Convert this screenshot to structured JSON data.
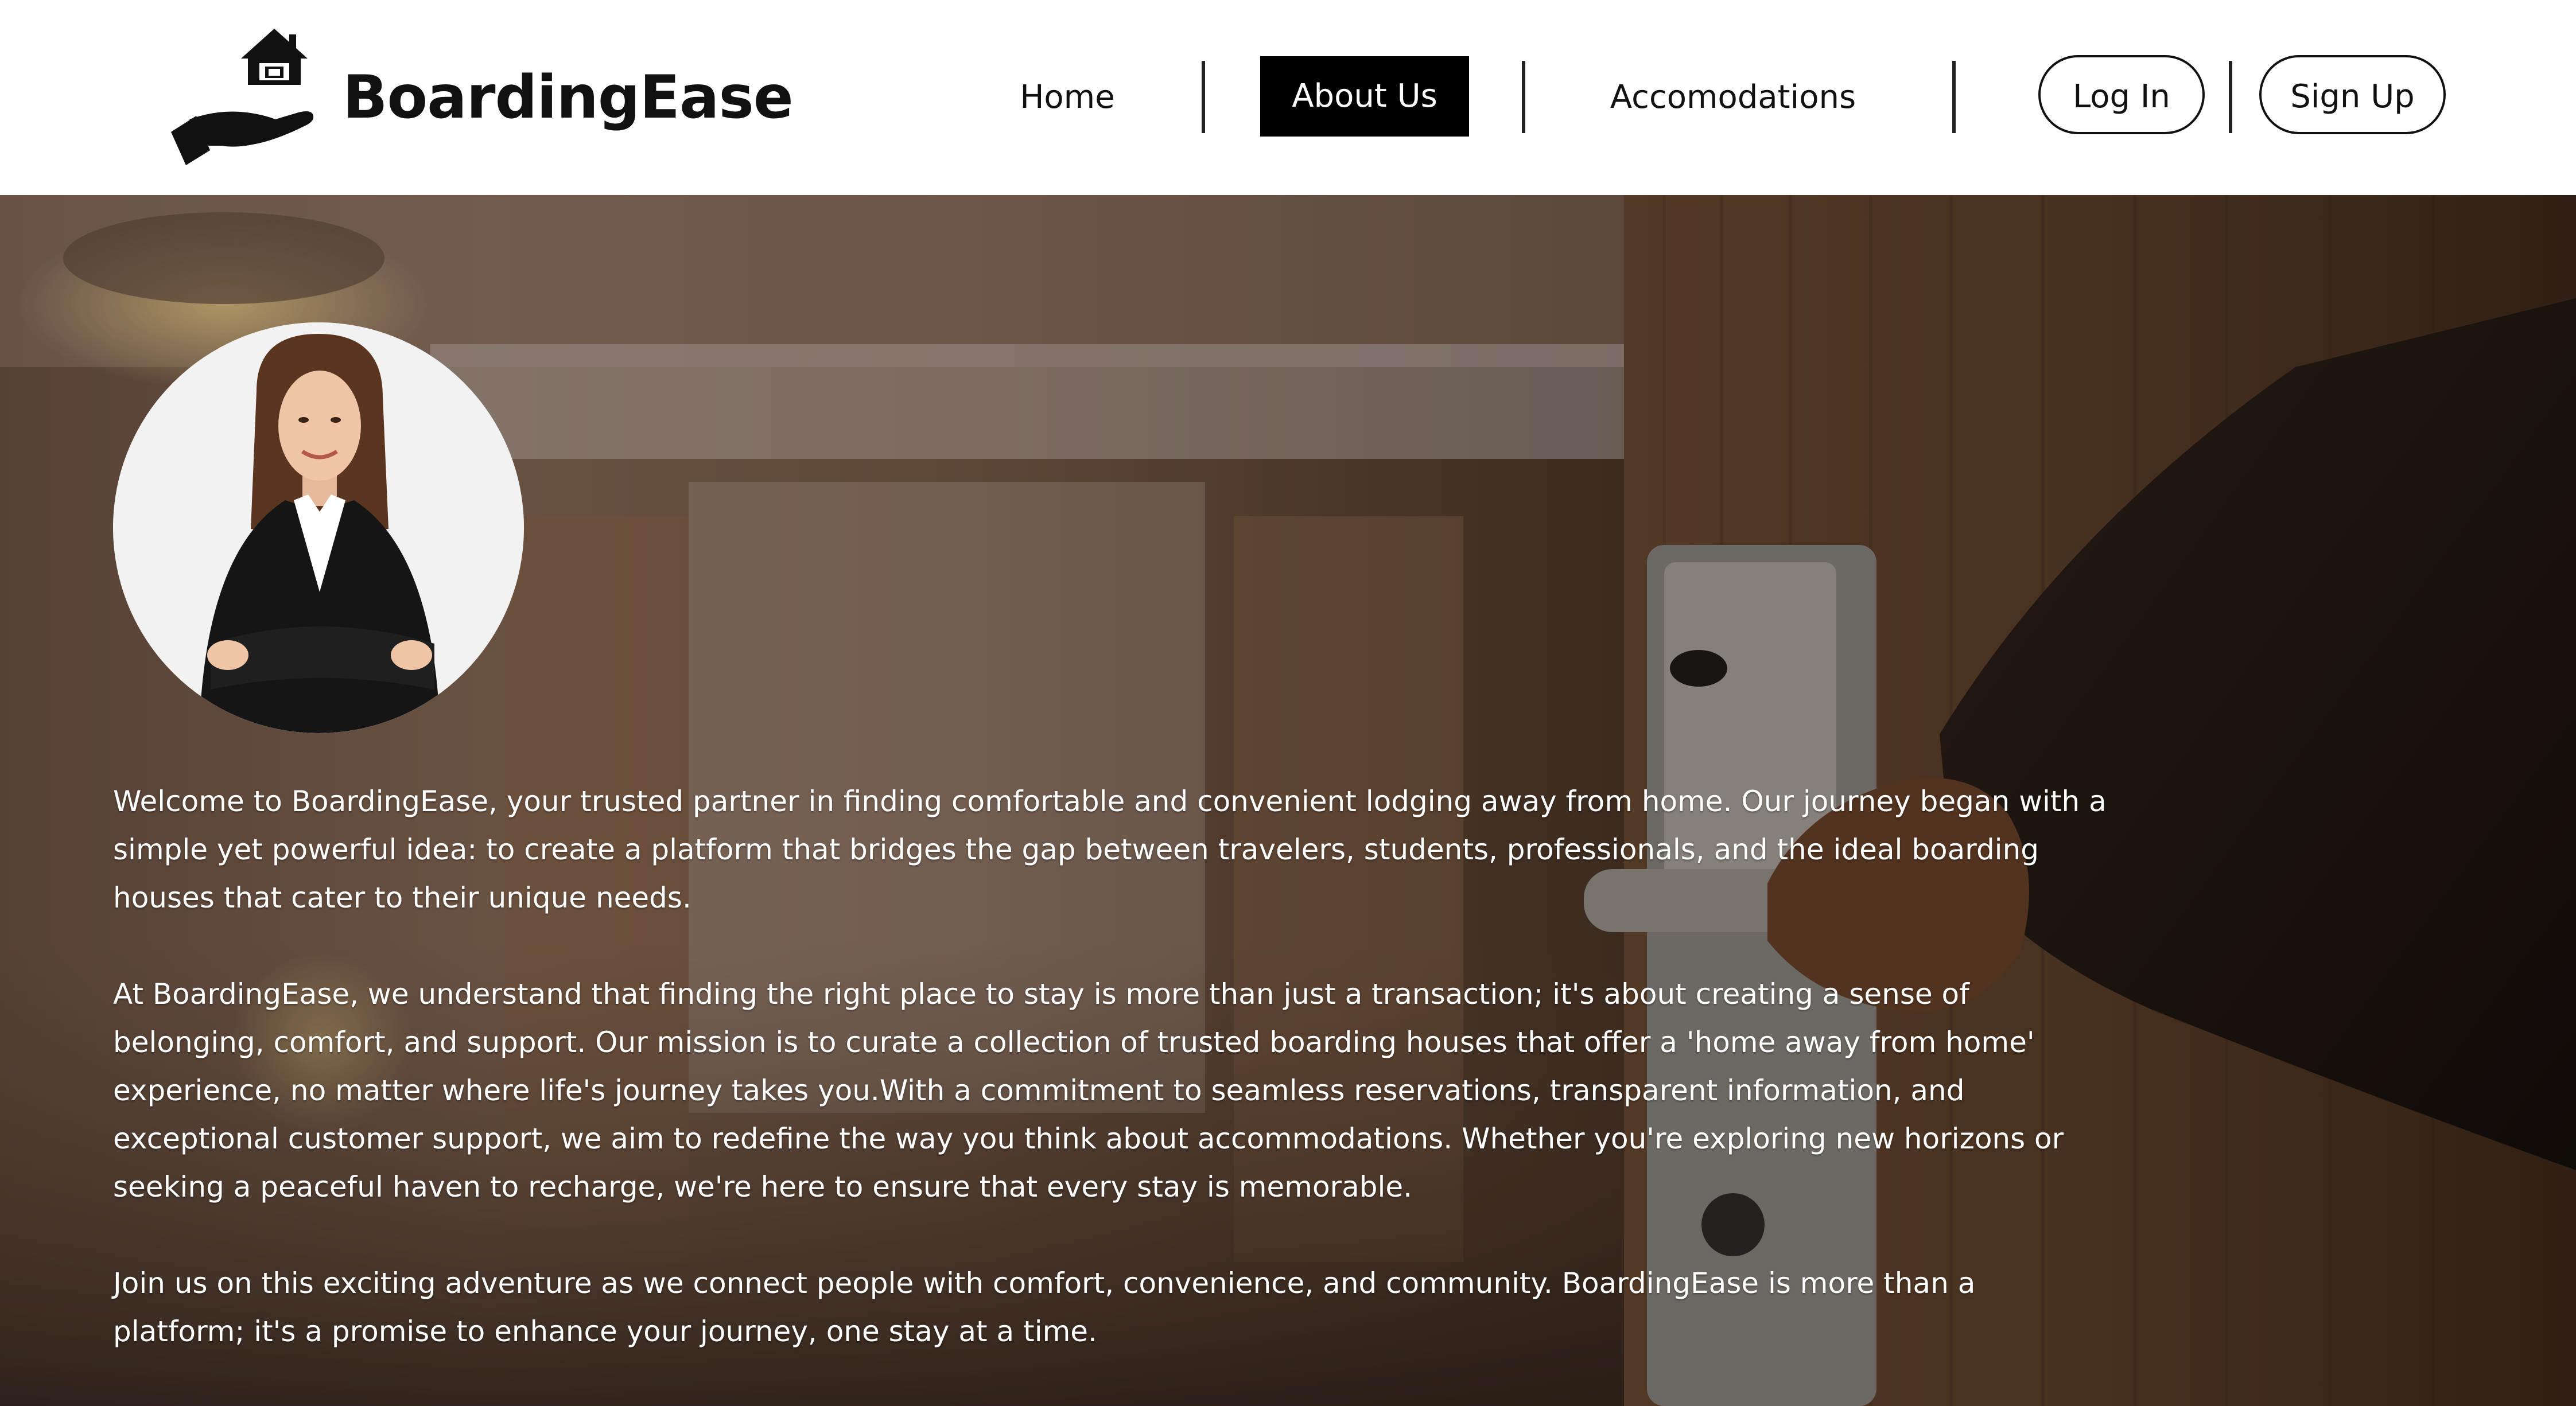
{
  "brand": {
    "name": "BoardingEase",
    "logo_icon": "house-in-hand-icon"
  },
  "nav": {
    "items": [
      {
        "label": "Home",
        "active": false
      },
      {
        "label": "About Us",
        "active": true
      },
      {
        "label": "Accomodations",
        "active": false
      }
    ],
    "login_label": "Log In",
    "signup_label": "Sign Up"
  },
  "hero": {
    "background": "hotel-room-door-photo",
    "avatar": "business-woman-portrait",
    "paragraphs": [
      "Welcome to BoardingEase, your trusted partner in finding comfortable and convenient lodging away from home. Our journey began with a simple yet powerful idea: to create a platform that bridges the gap between travelers, students, professionals, and the ideal boarding houses that cater to their unique needs.",
      "At BoardingEase, we understand that finding the right place to stay is more than just a transaction; it's about creating a sense of belonging, comfort, and support. Our mission is to curate a collection of trusted boarding houses that offer a 'home away from home' experience, no matter where life's journey takes you.With a commitment to seamless reservations, transparent information, and exceptional customer support, we aim to redefine the way you think about accommodations. Whether you're exploring new horizons or seeking a peaceful haven to recharge, we're here to ensure that every stay is memorable.",
      "Join us on this exciting adventure as we connect people with comfort, convenience, and community. BoardingEase is more than a platform; it's a promise to enhance your journey, one stay at a time."
    ]
  },
  "colors": {
    "header_bg": "#ffffff",
    "active_nav_bg": "#000000",
    "text_dark": "#111111",
    "text_light": "#ffffff"
  }
}
